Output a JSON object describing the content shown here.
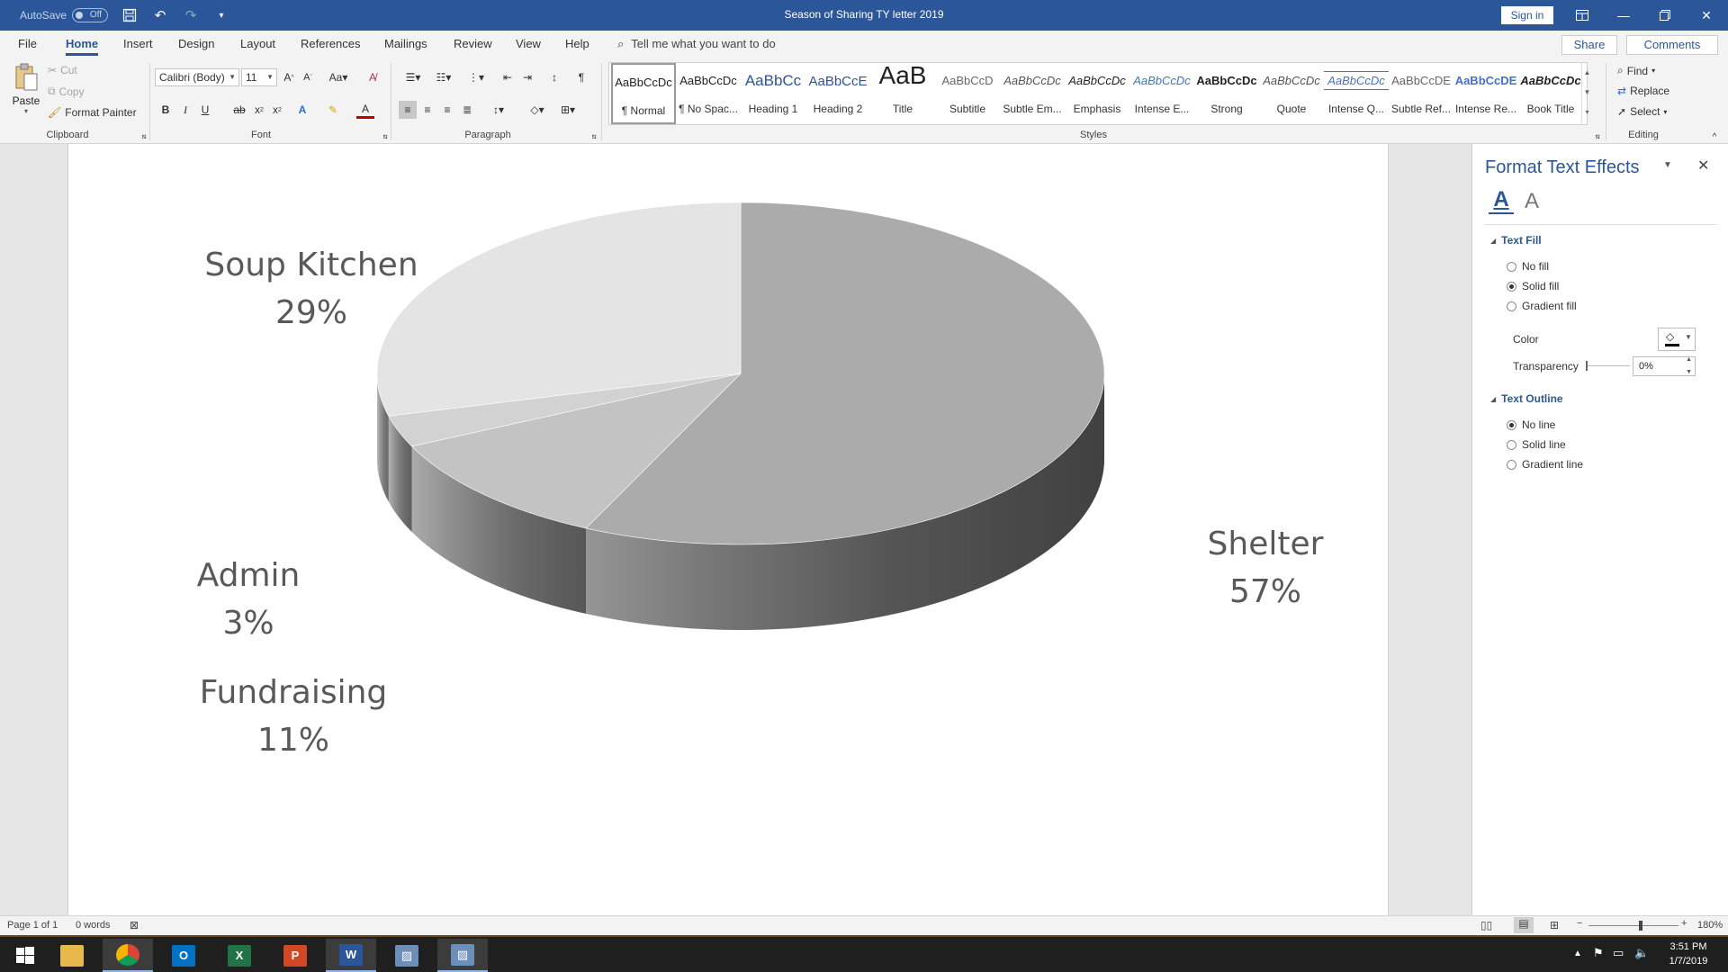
{
  "window": {
    "title": "Season of Sharing TY letter 2019",
    "autosave_label": "AutoSave",
    "autosave_state": "Off",
    "sign_in": "Sign in"
  },
  "tabs": [
    "File",
    "Home",
    "Insert",
    "Design",
    "Layout",
    "References",
    "Mailings",
    "Review",
    "View",
    "Help"
  ],
  "tell_me": "Tell me what you want to do",
  "share": "Share",
  "comments": "Comments",
  "clipboard": {
    "paste": "Paste",
    "cut": "Cut",
    "copy": "Copy",
    "format_painter": "Format Painter",
    "label": "Clipboard"
  },
  "font": {
    "name": "Calibri (Body)",
    "size": "11",
    "label": "Font"
  },
  "paragraph": {
    "label": "Paragraph"
  },
  "styles": {
    "label": "Styles",
    "items": [
      {
        "sample": "AaBbCcDc",
        "name": "¶ Normal"
      },
      {
        "sample": "AaBbCcDc",
        "name": "¶ No Spac..."
      },
      {
        "sample": "AaBbCc",
        "name": "Heading 1"
      },
      {
        "sample": "AaBbCcE",
        "name": "Heading 2"
      },
      {
        "sample": "AaB",
        "name": "Title"
      },
      {
        "sample": "AaBbCcD",
        "name": "Subtitle"
      },
      {
        "sample": "AaBbCcDc",
        "name": "Subtle Em..."
      },
      {
        "sample": "AaBbCcDc",
        "name": "Emphasis"
      },
      {
        "sample": "AaBbCcDc",
        "name": "Intense E..."
      },
      {
        "sample": "AaBbCcDc",
        "name": "Strong"
      },
      {
        "sample": "AaBbCcDc",
        "name": "Quote"
      },
      {
        "sample": "AaBbCcDc",
        "name": "Intense Q..."
      },
      {
        "sample": "AaBbCcDE",
        "name": "Subtle Ref..."
      },
      {
        "sample": "AaBbCcDE",
        "name": "Intense Re..."
      },
      {
        "sample": "AaBbCcDc",
        "name": "Book Title"
      }
    ]
  },
  "editing": {
    "find": "Find",
    "replace": "Replace",
    "select": "Select",
    "label": "Editing"
  },
  "chart_data": {
    "type": "pie",
    "categories": [
      "Shelter",
      "Fundraising",
      "Admin",
      "Soup Kitchen"
    ],
    "values": [
      57,
      11,
      3,
      29
    ],
    "labels": [
      {
        "name": "Soup Kitchen",
        "pct": "29%"
      },
      {
        "name": "Admin",
        "pct": "3%"
      },
      {
        "name": "Fundraising",
        "pct": "11%"
      },
      {
        "name": "Shelter",
        "pct": "57%"
      }
    ],
    "colors": [
      "#ababab",
      "#c3c3c3",
      "#d2d2d2",
      "#e4e4e4"
    ],
    "side_colors": [
      "#4a4a4a",
      "#8a8a8a",
      "#9d9d9d",
      "#b5b5b5"
    ],
    "style": "3d"
  },
  "pane": {
    "title": "Format Text Effects",
    "text_fill": "Text Fill",
    "fill_options": [
      "No fill",
      "Solid fill",
      "Gradient fill"
    ],
    "fill_selected": 1,
    "color_label": "Color",
    "transparency_label": "Transparency",
    "transparency_value": "0%",
    "text_outline": "Text Outline",
    "outline_options": [
      "No line",
      "Solid line",
      "Gradient line"
    ],
    "outline_selected": 0
  },
  "status": {
    "page": "Page 1 of 1",
    "words": "0 words",
    "zoom": "180%"
  },
  "clock": {
    "time": "3:51 PM",
    "date": "1/7/2019"
  }
}
